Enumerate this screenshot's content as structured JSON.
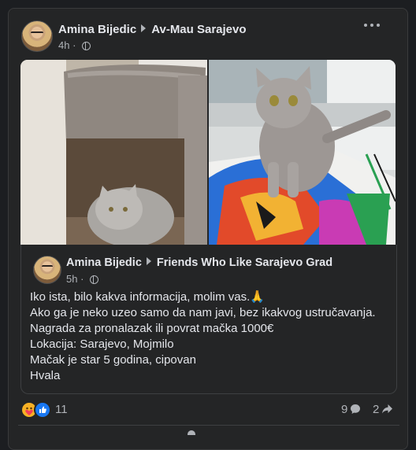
{
  "post": {
    "author": "Amina Bijedic",
    "group": "Av-Mau Sarajevo",
    "time": "4h",
    "privacy_icon": "globe-icon",
    "more_icon": "more-options-icon"
  },
  "shared_post": {
    "author": "Amina Bijedic",
    "group": "Friends Who Like Sarajevo Grad",
    "time": "5h",
    "privacy_icon": "globe-icon",
    "lines": [
      "Iko ista, bilo kakva informacija, molim vas.🙏",
      "Ako ga je neko uzeo samo da nam javi, bez ikakvog ustručavanja.",
      "Nagrada za pronalazak ili povrat mačka 1000€",
      "Lokacija: Sarajevo, Mojmilo",
      "Mačak je star 5 godina, cipovan",
      "Hvala"
    ]
  },
  "reactions": {
    "icons": [
      "care-reaction-icon",
      "like-reaction-icon"
    ],
    "count": "11",
    "comments": "9",
    "shares": "2"
  },
  "colors": {
    "background": "#1c1e21",
    "card": "#242526",
    "text_primary": "#e4e6eb",
    "text_secondary": "#b0b3b8",
    "like_blue": "#1877f2"
  }
}
